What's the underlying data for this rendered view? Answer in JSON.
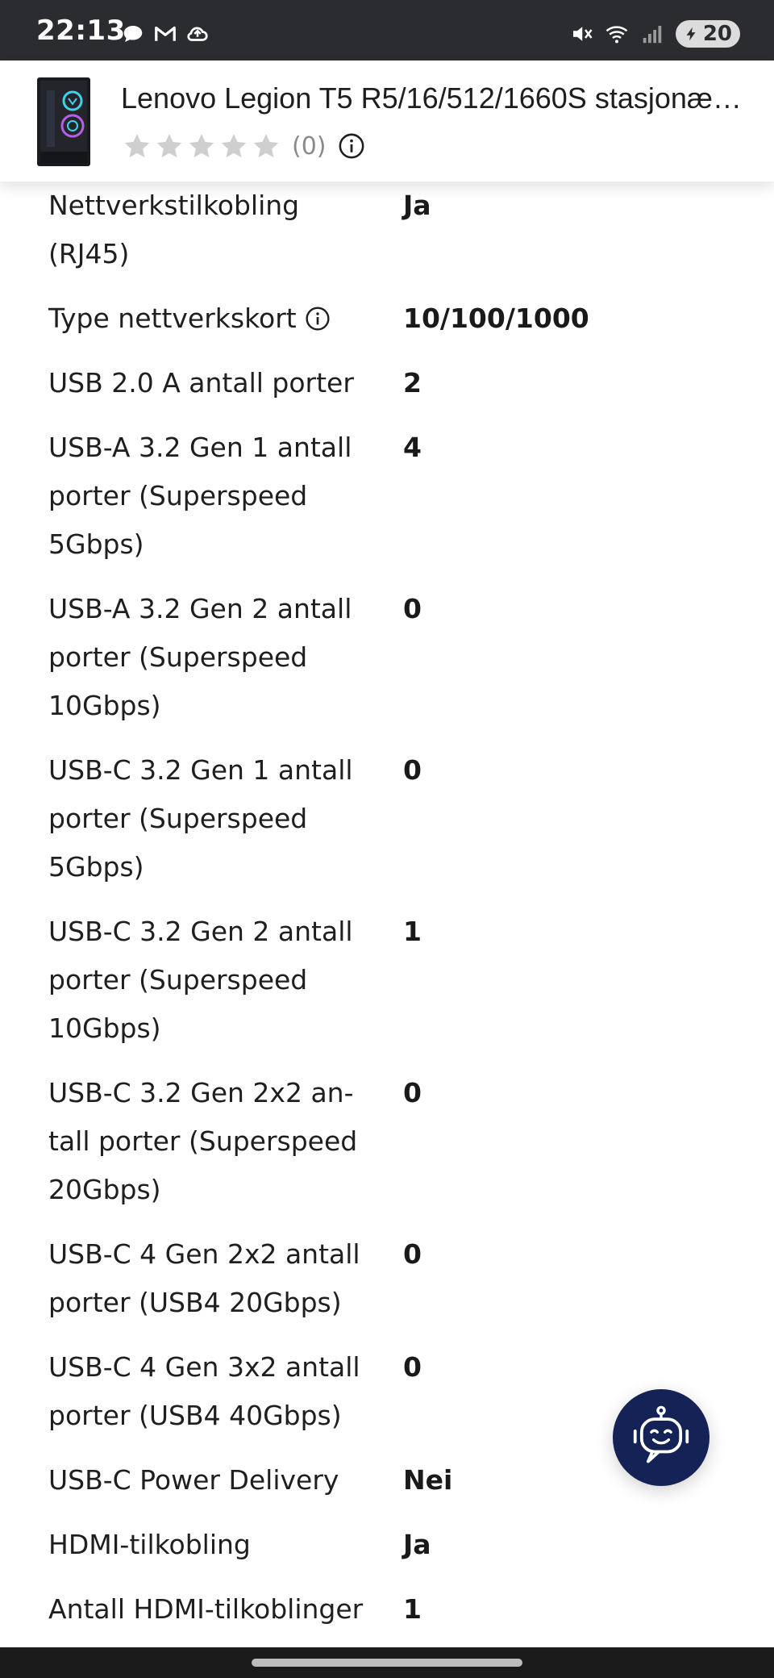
{
  "status_bar": {
    "time": "22:13",
    "battery_level": "20",
    "left_icons": [
      "chat-bubble-icon",
      "gmail-icon",
      "cloud-sync-icon"
    ],
    "right_icons": [
      "mute-vibrate-icon",
      "wifi-icon",
      "signal-icon",
      "battery-saver-icon"
    ]
  },
  "product": {
    "title": "Lenovo Legion T5 R5/16/512/1660S stasjonær...",
    "rating_stars": 0,
    "max_stars": 5,
    "review_count": "(0)"
  },
  "specs": [
    {
      "label": "Nettverkstilkobling (RJ45)",
      "value": "Ja",
      "has_info": false
    },
    {
      "label": "Type nettverkskort",
      "value": "10/100/1000",
      "has_info": true
    },
    {
      "label": "USB 2.0 A antall porter",
      "value": "2",
      "has_info": false
    },
    {
      "label": "USB-A 3.2 Gen 1 antall porter (Superspeed 5Gbps)",
      "value": "4",
      "has_info": false
    },
    {
      "label": "USB-A 3.2 Gen 2 antall porter (Superspeed 10Gbps)",
      "value": "0",
      "has_info": false
    },
    {
      "label": "USB-C 3.2 Gen 1 antall porter (Superspeed 5Gbps)",
      "value": "0",
      "has_info": false
    },
    {
      "label": "USB-C 3.2 Gen 2 antall porter (Superspeed 10Gbps)",
      "value": "1",
      "has_info": false
    },
    {
      "label": "USB-C 3.2 Gen 2x2 an­tall porter (Superspeed 20Gbps)",
      "value": "0",
      "has_info": false
    },
    {
      "label": "USB-C 4 Gen 2x2 antall porter (USB4 20Gbps)",
      "value": "0",
      "has_info": false
    },
    {
      "label": "USB-C 4 Gen 3x2 antall porter (USB4 40Gbps)",
      "value": "0",
      "has_info": false
    },
    {
      "label": "USB-C Power Delivery",
      "value": "Nei",
      "has_info": false
    },
    {
      "label": "HDMI-tilkobling",
      "value": "Ja",
      "has_info": false
    },
    {
      "label": "Antall HDMI-tilkoblinger",
      "value": "1",
      "has_info": false
    }
  ],
  "colors": {
    "status_bar_bg": "#2b2c30",
    "chatbot_bg": "#152255",
    "star_empty": "#cfcfcf",
    "text": "#1f1f1f"
  }
}
